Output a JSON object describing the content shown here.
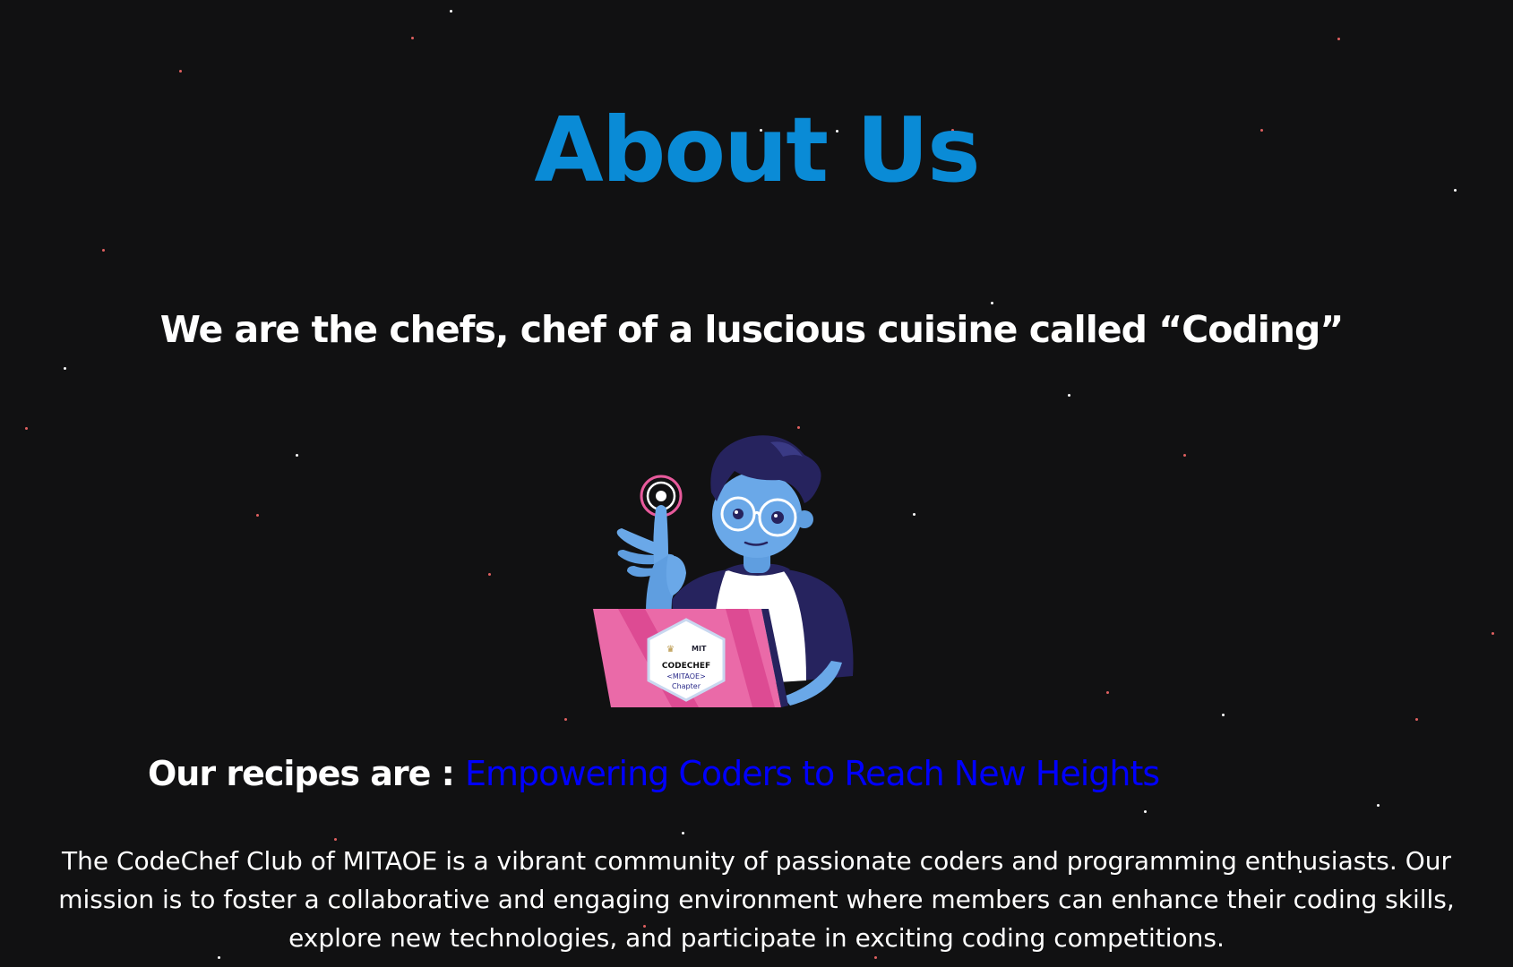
{
  "about": {
    "title": "About Us",
    "title_color": "#0a8bd6",
    "tagline": "We are the chefs, chef of a luscious cuisine called “Coding”",
    "recipes_prefix": "Our recipes are : ",
    "recipes_highlight": "Empowering Coders to Reach New Heights",
    "highlight_color": "#0000ff",
    "description": "The CodeChef Club of MITAOE is a vibrant community of passionate coders and programming enthusiasts. Our mission is to foster a collaborative and engaging environment where members can enhance their coding skills, explore new technologies, and participate in exciting coding competitions."
  },
  "illustration": {
    "icon": "coder-with-laptop-illustration",
    "badge": {
      "brand": "CODECHEF",
      "org": "MIT",
      "chapter_line1": "<MITAOE>",
      "chapter_line2": "Chapter"
    }
  },
  "theme": {
    "background": "#111112",
    "text": "#ffffff",
    "star_white": "#ffffff",
    "star_red": "#e06060"
  }
}
